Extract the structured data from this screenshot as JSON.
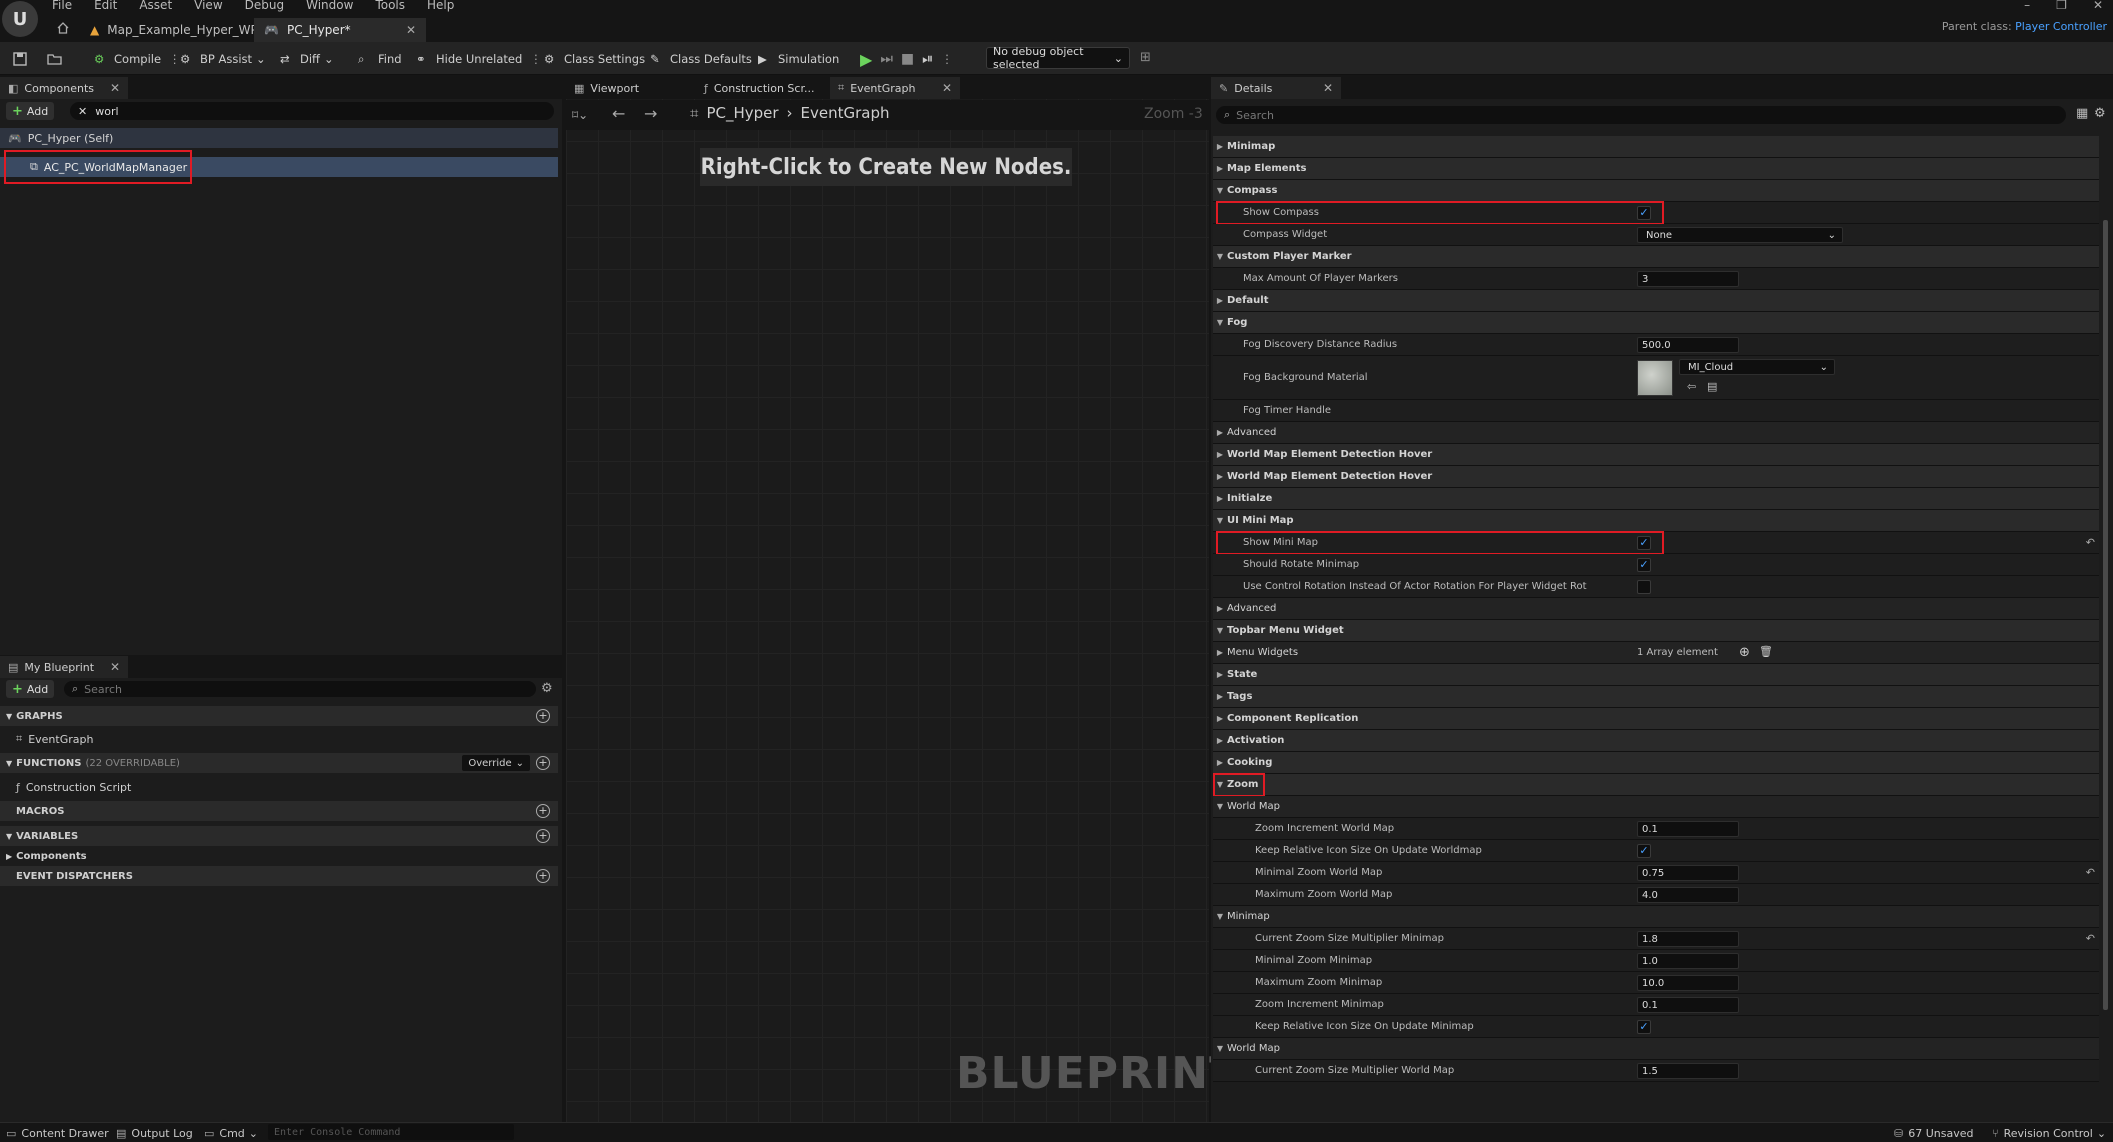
{
  "menu": [
    "File",
    "Edit",
    "Asset",
    "View",
    "Debug",
    "Window",
    "Tools",
    "Help"
  ],
  "tabs": {
    "map": "Map_Example_Hyper_WP",
    "pc": "PC_Hyper*"
  },
  "parent_class": {
    "label": "Parent class:",
    "value": "Player Controller"
  },
  "toolbar": {
    "compile": "Compile",
    "bp_assist": "BP Assist",
    "diff": "Diff",
    "find": "Find",
    "hide_unrelated": "Hide Unrelated",
    "class_settings": "Class Settings",
    "class_defaults": "Class Defaults",
    "simulation": "Simulation",
    "debug_object": "No debug object selected"
  },
  "components": {
    "tab": "Components",
    "add": "Add",
    "search_value": "worl",
    "self": "PC_Hyper (Self)",
    "item": "AC_PC_WorldMapManager"
  },
  "mybp": {
    "tab": "My Blueprint",
    "add": "Add",
    "search_placeholder": "Search",
    "graphs": "GRAPHS",
    "event_graph": "EventGraph",
    "functions": "FUNCTIONS",
    "functions_count": "(22 OVERRIDABLE)",
    "override": "Override",
    "construction": "Construction Script",
    "macros": "MACROS",
    "variables": "VARIABLES",
    "components": "Components",
    "dispatchers": "EVENT DISPATCHERS"
  },
  "graph": {
    "tabs": [
      "Viewport",
      "Construction Scr...",
      "EventGraph"
    ],
    "crumb_root": "PC_Hyper",
    "crumb_leaf": "EventGraph",
    "zoom": "Zoom -3",
    "hint": "Right-Click to Create New Nodes.",
    "watermark": "BLUEPRINT"
  },
  "details": {
    "tab": "Details",
    "search_placeholder": "Search",
    "rows": [
      {
        "t": "cat",
        "label": "Minimap",
        "open": false
      },
      {
        "t": "cat",
        "label": "Map Elements",
        "open": false
      },
      {
        "t": "cat",
        "label": "Compass",
        "open": true
      },
      {
        "t": "prop",
        "label": "Show Compass",
        "check": true,
        "indent": 1
      },
      {
        "t": "prop",
        "label": "Compass Widget",
        "select": "None",
        "indent": 1
      },
      {
        "t": "cat",
        "label": "Custom Player Marker",
        "open": true
      },
      {
        "t": "prop",
        "label": "Max Amount Of Player Markers",
        "value": "3",
        "indent": 1
      },
      {
        "t": "cat",
        "label": "Default",
        "open": false
      },
      {
        "t": "cat",
        "label": "Fog",
        "open": true
      },
      {
        "t": "prop",
        "label": "Fog Discovery Distance Radius",
        "value": "500.0",
        "indent": 1
      },
      {
        "t": "prop",
        "label": "Fog Background Material",
        "material": "MI_Cloud",
        "indent": 1,
        "tall": true
      },
      {
        "t": "prop",
        "label": "Fog Timer Handle",
        "indent": 1
      },
      {
        "t": "sub",
        "label": "Advanced",
        "open": false
      },
      {
        "t": "cat",
        "label": "World Map Element Detection Hover",
        "open": false
      },
      {
        "t": "cat",
        "label": "World Map Element Detection Hover",
        "open": false
      },
      {
        "t": "cat",
        "label": "Initialze",
        "open": false
      },
      {
        "t": "cat",
        "label": "UI Mini Map",
        "open": true
      },
      {
        "t": "prop",
        "label": "Show Mini Map",
        "check": true,
        "indent": 1,
        "reset": true
      },
      {
        "t": "prop",
        "label": "Should Rotate Minimap",
        "check": true,
        "indent": 1
      },
      {
        "t": "prop",
        "label": "Use Control Rotation Instead Of Actor Rotation For Player Widget Rot",
        "check": false,
        "indent": 1
      },
      {
        "t": "sub",
        "label": "Advanced",
        "open": false
      },
      {
        "t": "cat",
        "label": "Topbar Menu Widget",
        "open": true
      },
      {
        "t": "sub",
        "label": "Menu Widgets",
        "array": "1 Array element",
        "open": false
      },
      {
        "t": "cat",
        "label": "State",
        "open": false
      },
      {
        "t": "cat",
        "label": "Tags",
        "open": false
      },
      {
        "t": "cat",
        "label": "Component Replication",
        "open": false
      },
      {
        "t": "cat",
        "label": "Activation",
        "open": false
      },
      {
        "t": "cat",
        "label": "Cooking",
        "open": false
      },
      {
        "t": "cat",
        "label": "Zoom",
        "open": true
      },
      {
        "t": "sub",
        "label": "World Map",
        "open": true
      },
      {
        "t": "prop",
        "label": "Zoom Increment World Map",
        "value": "0.1",
        "indent": 2
      },
      {
        "t": "prop",
        "label": "Keep Relative Icon Size On Update Worldmap",
        "check": true,
        "indent": 2
      },
      {
        "t": "prop",
        "label": "Minimal Zoom World Map",
        "value": "0.75",
        "indent": 2,
        "reset": true
      },
      {
        "t": "prop",
        "label": "Maximum Zoom World Map",
        "value": "4.0",
        "indent": 2
      },
      {
        "t": "sub",
        "label": "Minimap",
        "open": true
      },
      {
        "t": "prop",
        "label": "Current Zoom Size Multiplier Minimap",
        "value": "1.8",
        "indent": 2,
        "reset": true
      },
      {
        "t": "prop",
        "label": "Minimal Zoom Minimap",
        "value": "1.0",
        "indent": 2
      },
      {
        "t": "prop",
        "label": "Maximum Zoom Minimap",
        "value": "10.0",
        "indent": 2
      },
      {
        "t": "prop",
        "label": "Zoom Increment Minimap",
        "value": "0.1",
        "indent": 2
      },
      {
        "t": "prop",
        "label": "Keep Relative Icon Size On Update Minimap",
        "check": true,
        "indent": 2
      },
      {
        "t": "sub",
        "label": "World Map",
        "open": true
      },
      {
        "t": "prop",
        "label": "Current Zoom Size Multiplier World Map",
        "value": "1.5",
        "indent": 2
      }
    ]
  },
  "statusbar": {
    "content_drawer": "Content Drawer",
    "output_log": "Output Log",
    "cmd": "Cmd",
    "console_placeholder": "Enter Console Command",
    "unsaved": "67 Unsaved",
    "revision": "Revision Control"
  },
  "colors": {
    "accent": "#4aa1ff",
    "highlight": "#e01b24",
    "play": "#6cd35d",
    "selected_row": "#3a4a62"
  }
}
